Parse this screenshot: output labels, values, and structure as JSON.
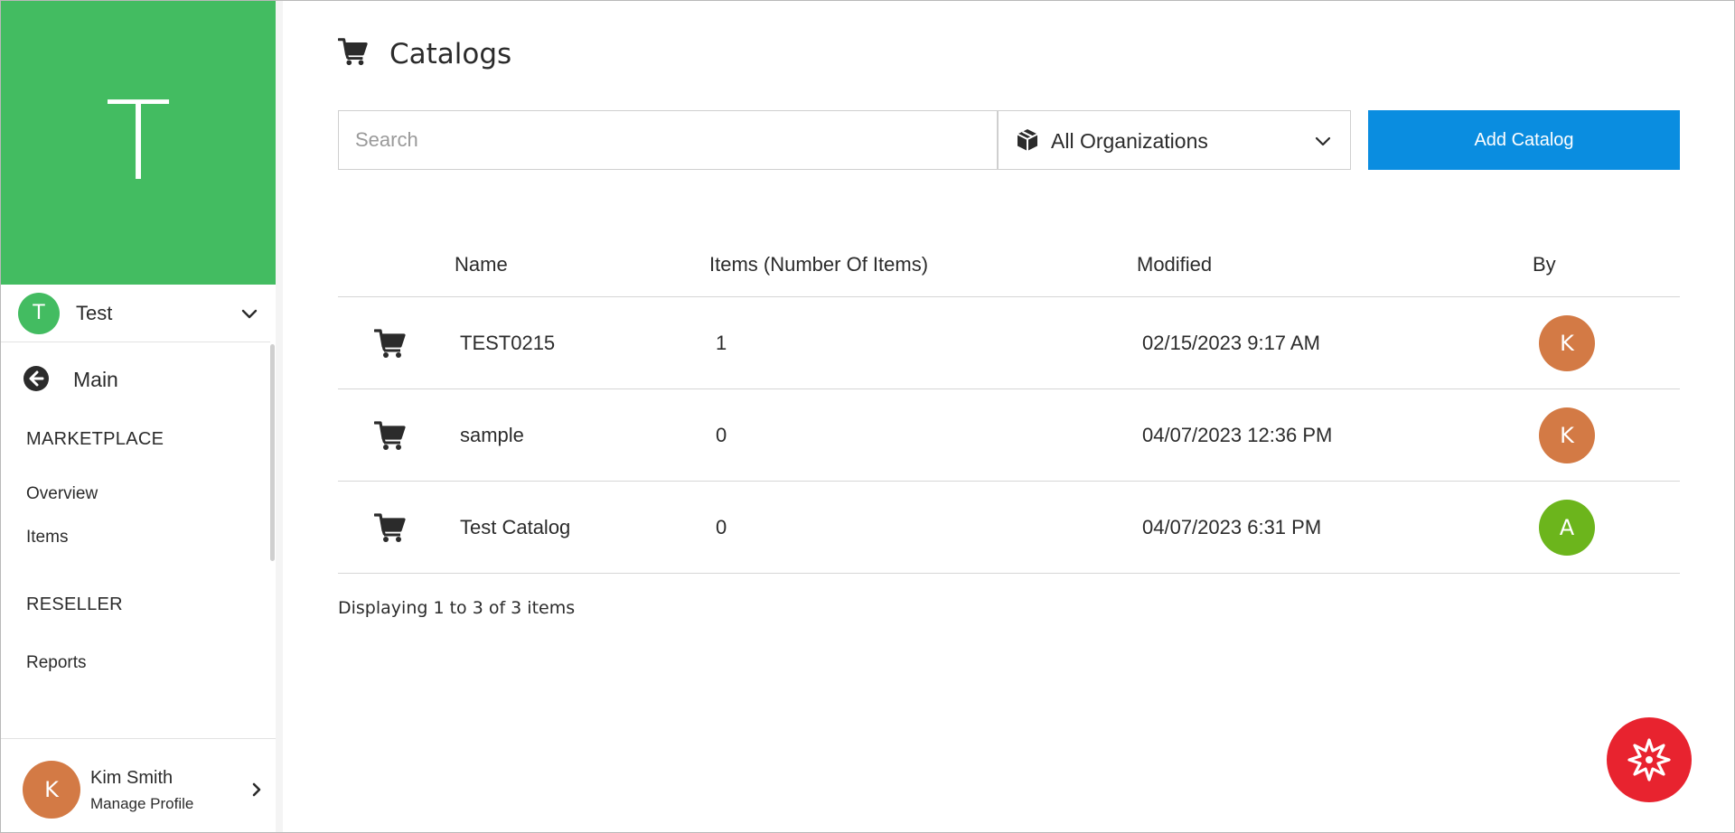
{
  "sidebar": {
    "org_letter": "T",
    "org_avatar_letter": "T",
    "org_name": "Test",
    "back_label": "Main",
    "sections": [
      {
        "title": "MARKETPLACE",
        "items": [
          "Overview",
          "Items"
        ]
      },
      {
        "title": "RESELLER",
        "items": [
          "Reports"
        ]
      }
    ],
    "profile": {
      "avatar_letter": "K",
      "name": "Kim Smith",
      "sub": "Manage Profile"
    }
  },
  "main": {
    "title": "Catalogs",
    "search": {
      "placeholder": "Search",
      "value": ""
    },
    "org_filter": {
      "selected": "All Organizations"
    },
    "add_button_label": "Add Catalog",
    "table": {
      "columns": [
        "Name",
        "Items (Number Of Items)",
        "Modified",
        "By"
      ],
      "rows": [
        {
          "name": "TEST0215",
          "items": "1",
          "modified": "02/15/2023 9:17 AM",
          "by": "K",
          "by_color": "#d37a45"
        },
        {
          "name": "sample",
          "items": "0",
          "modified": "04/07/2023 12:36 PM",
          "by": "K",
          "by_color": "#d37a45"
        },
        {
          "name": "Test Catalog",
          "items": "0",
          "modified": "04/07/2023 6:31 PM",
          "by": "A",
          "by_color": "#6cb51c"
        }
      ]
    },
    "footer": "Displaying 1 to 3 of 3 items"
  },
  "colors": {
    "brand_green": "#43bc61",
    "primary_button": "#0a8de0",
    "fab_red": "#e8232f"
  },
  "icons": {
    "title": "cart-icon",
    "org_filter": "cube-icon",
    "back": "arrow-left-circle-icon",
    "fab": "starburst-icon"
  }
}
